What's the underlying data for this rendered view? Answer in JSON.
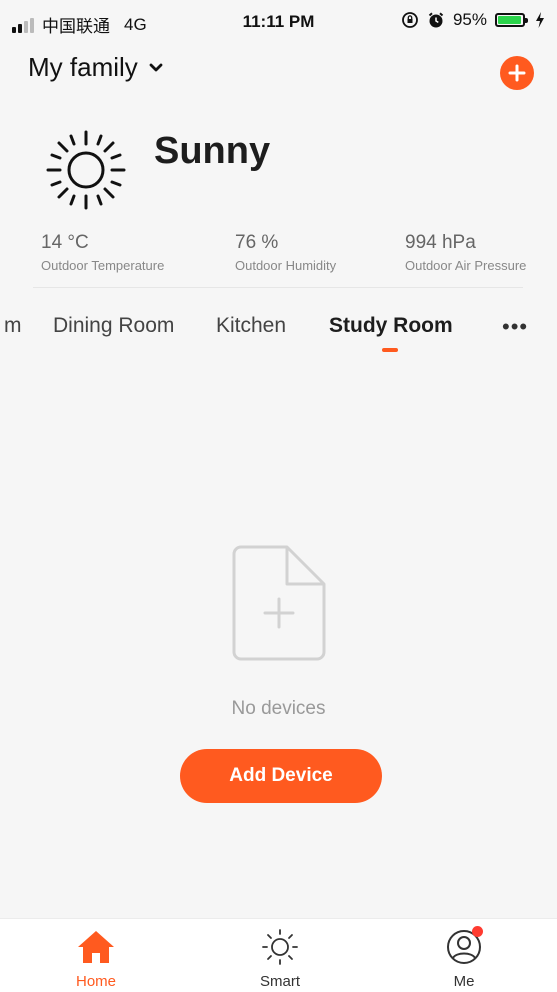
{
  "status_bar": {
    "carrier": "中国联通",
    "network": "4G",
    "time": "11:11 PM",
    "battery": "95%",
    "battery_level": 0.95,
    "icons": [
      "signal-icon",
      "orientation-lock-icon",
      "alarm-icon",
      "battery-icon",
      "charging-icon"
    ]
  },
  "header": {
    "family_name": "My family",
    "dropdown_icon": "chevron-down-icon",
    "add_icon": "plus-icon"
  },
  "weather": {
    "icon": "sun-icon",
    "condition": "Sunny",
    "stats": [
      {
        "value": "14 °C",
        "label": "Outdoor Temperature"
      },
      {
        "value": "76 %",
        "label": "Outdoor Humidity"
      },
      {
        "value": "994 hPa",
        "label": "Outdoor Air Pressure"
      }
    ]
  },
  "rooms": {
    "tabs": [
      "m",
      "Dining Room",
      "Kitchen",
      "Study Room"
    ],
    "active": "Study Room",
    "more_icon": "more-icon"
  },
  "empty_state": {
    "icon": "empty-document-icon",
    "message": "No devices",
    "button": "Add Device"
  },
  "bottom_nav": {
    "items": [
      {
        "label": "Home",
        "icon": "home-icon",
        "active": true
      },
      {
        "label": "Smart",
        "icon": "smart-icon",
        "active": false
      },
      {
        "label": "Me",
        "icon": "profile-icon",
        "active": false,
        "badge": true
      }
    ]
  },
  "colors": {
    "accent": "#ff5a1f",
    "background": "#f6f6f6",
    "battery": "#2bd44b",
    "badge": "#ff3b30"
  }
}
